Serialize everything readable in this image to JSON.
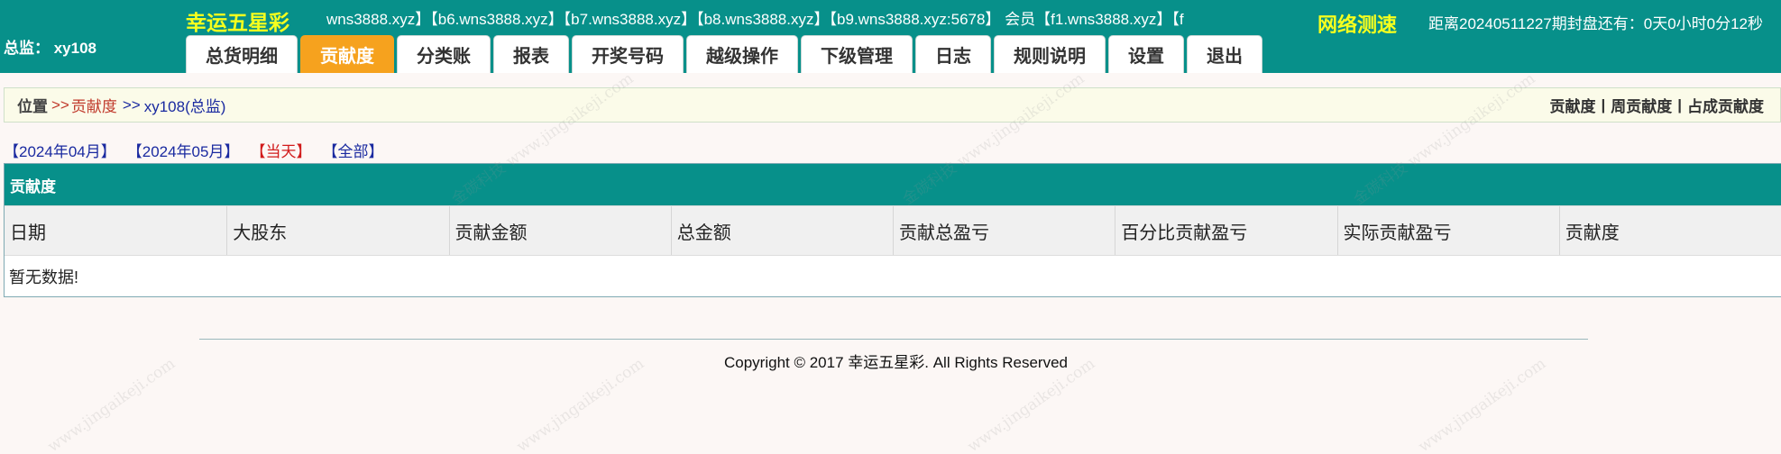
{
  "header": {
    "role_label": "总监： xy108",
    "logo": "幸运五星彩",
    "marquee": "wns3888.xyz】【b6.wns3888.xyz】【b7.wns3888.xyz】【b8.wns3888.xyz】【b9.wns3888.xyz:5678】 会员【f1.wns3888.xyz】【f",
    "speed_test": "网络测速",
    "countdown": "距离20240511227期封盘还有：0天0小时0分12秒"
  },
  "nav": {
    "tabs": [
      "总货明细",
      "贡献度",
      "分类账",
      "报表",
      "开奖号码",
      "越级操作",
      "下级管理",
      "日志",
      "规则说明",
      "设置",
      "退出"
    ],
    "active_index": 1
  },
  "breadcrumb": {
    "root": "位置",
    "sep": ">>",
    "current": "贡献度",
    "user": "xy108(总监)",
    "links": [
      "贡献度",
      "周贡献度",
      "占成贡献度"
    ],
    "pipe": "|"
  },
  "filters": [
    "【2024年04月】",
    "【2024年05月】",
    "【当天】",
    "【全部】"
  ],
  "table": {
    "title": "贡献度",
    "columns": [
      "日期",
      "大股东",
      "贡献金额",
      "总金额",
      "贡献总盈亏",
      "百分比贡献盈亏",
      "实际贡献盈亏",
      "贡献度"
    ],
    "empty_text": "暂无数据!"
  },
  "footer": {
    "copyright": "Copyright © 2017 幸运五星彩. All Rights Reserved"
  },
  "colors": {
    "header_bg": "#07908a",
    "accent_yellow": "#f6ff1e",
    "active_tab": "#f6a21e",
    "link_blue": "#1a2aa0",
    "link_red": "#d11b1b"
  }
}
